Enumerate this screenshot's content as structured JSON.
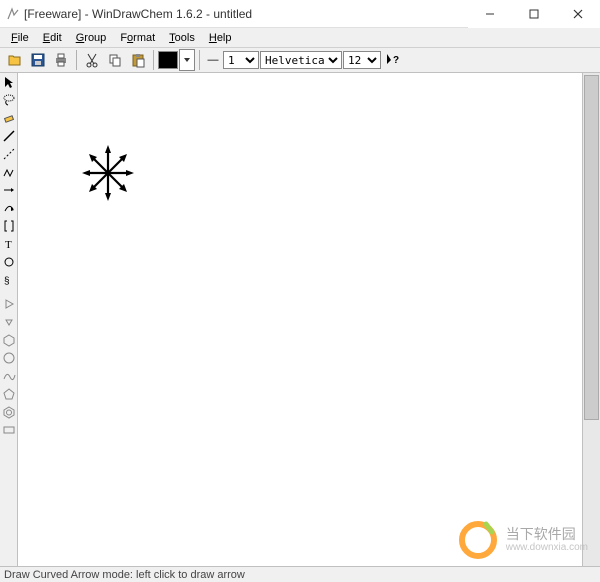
{
  "window": {
    "title": "[Freeware] - WinDrawChem 1.6.2 - untitled",
    "minimize_label": "Minimize",
    "maximize_label": "Maximize",
    "close_label": "Close"
  },
  "menus": {
    "file": "File",
    "edit": "Edit",
    "group": "Group",
    "format": "Format",
    "tools": "Tools",
    "help": "Help"
  },
  "toolbar": {
    "open": "Open",
    "save": "Save",
    "print": "Print",
    "cut": "Cut",
    "copy": "Copy",
    "paste": "Paste",
    "color_label": "Black",
    "line_width": "1",
    "font": "Helvetica",
    "font_size": "12",
    "whats_this": "What's This?"
  },
  "left_tools": [
    {
      "name": "pointer-tool",
      "icon": "pointer"
    },
    {
      "name": "lasso-tool",
      "icon": "lasso"
    },
    {
      "name": "eraser-tool",
      "icon": "eraser"
    },
    {
      "name": "line-tool",
      "icon": "line"
    },
    {
      "name": "dashed-line-tool",
      "icon": "dashed"
    },
    {
      "name": "chain-tool",
      "icon": "chain"
    },
    {
      "name": "arrow-tool",
      "icon": "arrow"
    },
    {
      "name": "curved-arrow-tool",
      "icon": "curved-arrow"
    },
    {
      "name": "bracket-tool",
      "icon": "bracket"
    },
    {
      "name": "text-tool",
      "icon": "text"
    },
    {
      "name": "ring-tool",
      "icon": "ring"
    },
    {
      "name": "symbol-tool",
      "icon": "symbol"
    },
    {
      "name": "sep",
      "icon": "sep"
    },
    {
      "name": "play-tool",
      "icon": "play"
    },
    {
      "name": "down-tool",
      "icon": "down"
    },
    {
      "name": "hexagon-tool",
      "icon": "hexagon"
    },
    {
      "name": "circle-tool",
      "icon": "circle"
    },
    {
      "name": "spline-tool",
      "icon": "spline"
    },
    {
      "name": "cyclopentane-tool",
      "icon": "cyclo"
    },
    {
      "name": "benzene-tool",
      "icon": "benzene"
    },
    {
      "name": "label-tool",
      "icon": "label"
    }
  ],
  "status": {
    "text": "Draw Curved Arrow mode: left click to draw arrow"
  },
  "watermark": {
    "name": "当下软件园",
    "url": "www.downxia.com"
  },
  "colors": {
    "accent": "#ff9a1a",
    "icon_yellow": "#f6c344",
    "icon_blue": "#2b5797",
    "ui_gray": "#f0f0f0"
  }
}
